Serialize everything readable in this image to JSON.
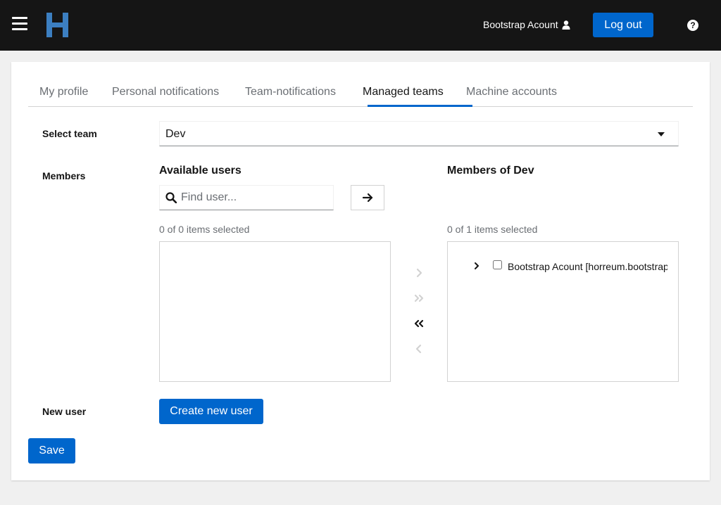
{
  "header": {
    "account_name": "Bootstrap Acount",
    "logout_label": "Log out",
    "help_glyph": "?",
    "brand_color": "#3c7fc1"
  },
  "tabs": [
    {
      "label": "My profile",
      "active": false
    },
    {
      "label": "Personal notifications",
      "active": false
    },
    {
      "label": "Team-notifications",
      "active": false
    },
    {
      "label": "Managed teams",
      "active": true
    },
    {
      "label": "Machine accounts",
      "active": false
    }
  ],
  "form": {
    "select_team_label": "Select team",
    "selected_team": "Dev",
    "members_label": "Members",
    "new_user_label": "New user",
    "create_user_button": "Create new user",
    "save_button": "Save"
  },
  "available": {
    "title": "Available users",
    "search_placeholder": "Find user...",
    "status": "0 of 0 items selected",
    "items": []
  },
  "members": {
    "title": "Members of Dev",
    "status": "0 of 1 items selected",
    "items": [
      {
        "label": "Bootstrap Acount [horreum.bootstrap]",
        "checked": false
      }
    ]
  },
  "icons": {
    "menu": "hamburger-icon",
    "logo": "horreum-logo",
    "user": "user-icon",
    "help": "question-circle-icon",
    "search": "search-icon",
    "arrow": "arrow-right-icon",
    "add_selected": "angle-right-icon",
    "add_all": "angle-double-right-icon",
    "remove_all": "angle-double-left-icon",
    "remove_selected": "angle-left-icon",
    "expand": "angle-right-icon"
  },
  "colors": {
    "primary": "#0066cc",
    "header_bg": "#151515",
    "page_bg": "#f0f0f0"
  }
}
